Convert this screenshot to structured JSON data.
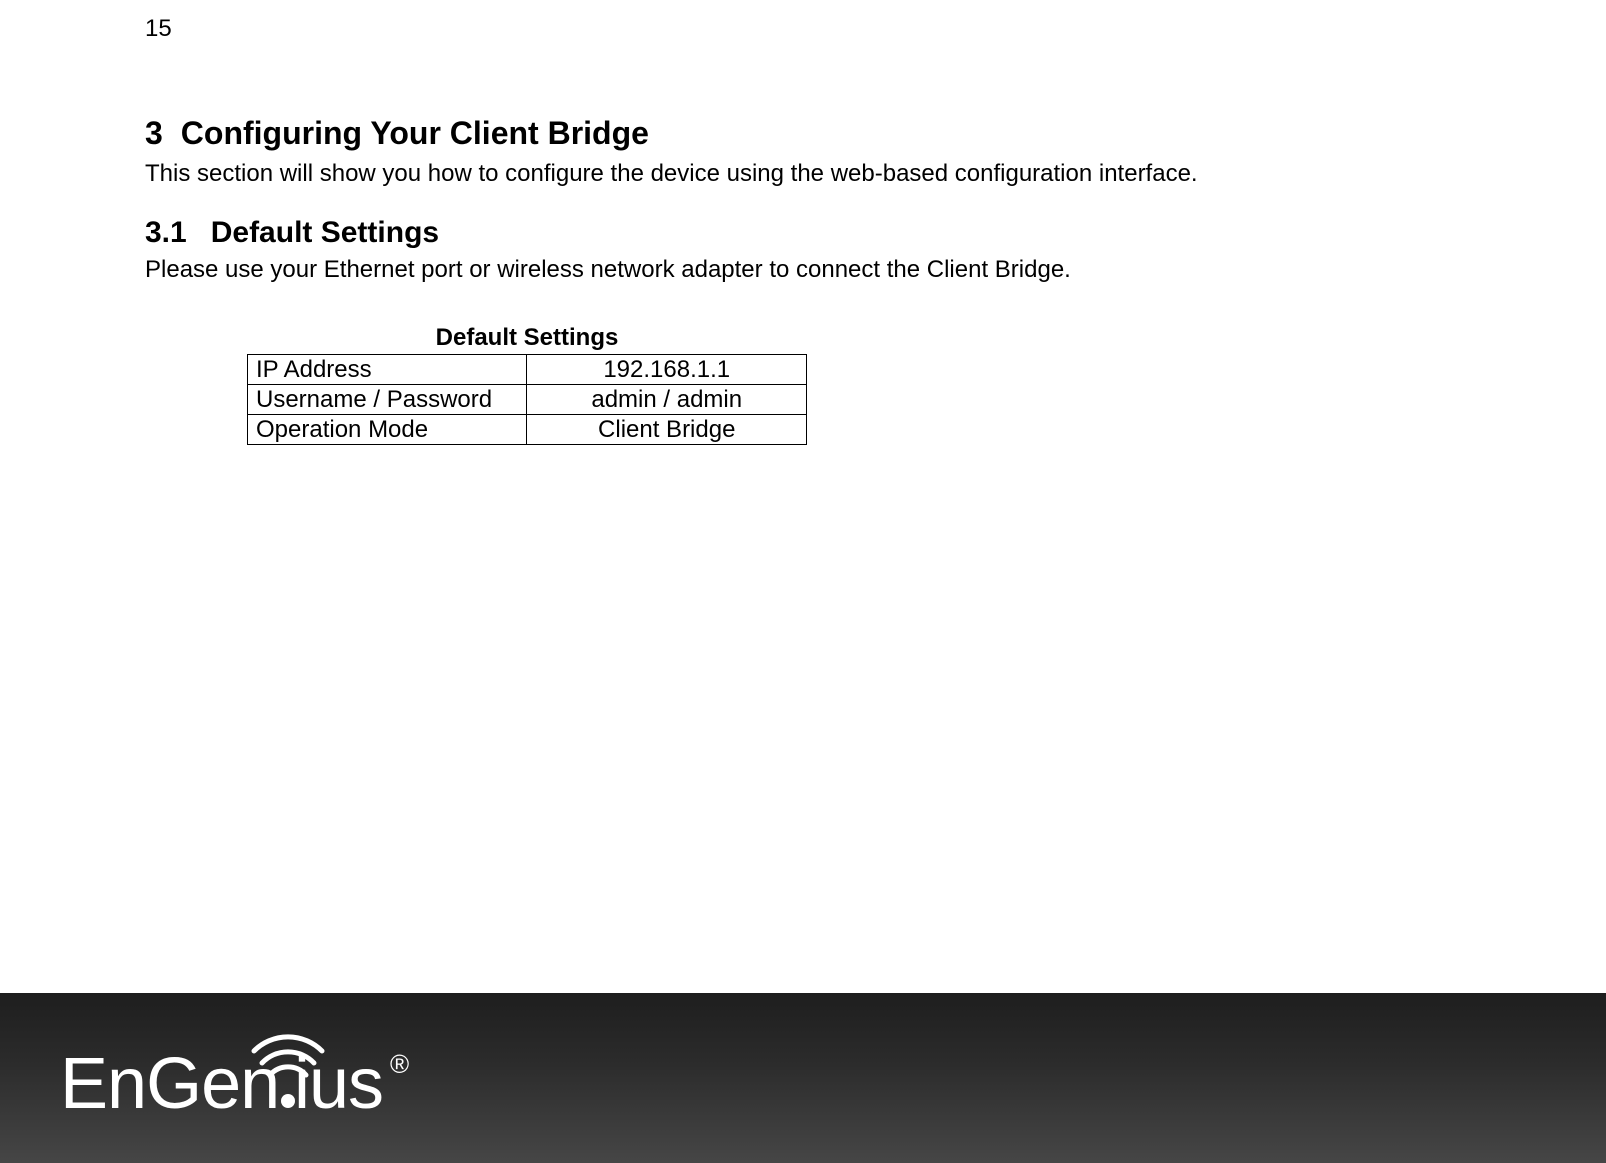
{
  "page_number": "15",
  "heading1": {
    "number": "3",
    "title": "Configuring Your Client Bridge"
  },
  "intro_text": "This section will show you how to configure the device using the web-based configuration interface.",
  "heading2": {
    "number": "3.1",
    "title": "Default Settings"
  },
  "sub_text": "Please use your Ethernet port or wireless network adapter to connect the Client Bridge.",
  "table": {
    "title": "Default Settings",
    "rows": [
      {
        "label": "IP Address",
        "value": "192.168.1.1"
      },
      {
        "label": "Username / Password",
        "value": "admin / admin"
      },
      {
        "label": "Operation Mode",
        "value": "Client Bridge"
      }
    ]
  },
  "brand": "EnGenius",
  "brand_reg": "®"
}
